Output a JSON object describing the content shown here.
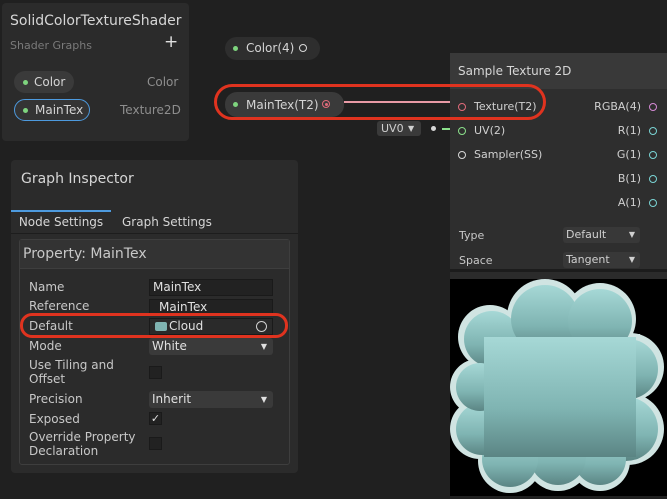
{
  "blackboard": {
    "title": "SolidColorTextureShader",
    "subtitle": "Shader Graphs",
    "add_label": "+",
    "properties": [
      {
        "name": "Color",
        "type": "Color"
      },
      {
        "name": "MainTex",
        "type": "Texture2D"
      }
    ]
  },
  "graph": {
    "color_node_label": "Color(4)",
    "maintex_node_label": "MainTex(T2)",
    "uv_value": "UV0",
    "accent_wire_color": "#e89aa6",
    "highlight_color": "#e0331f"
  },
  "sample_node": {
    "title": "Sample Texture 2D",
    "inputs": [
      "Texture(T2)",
      "UV(2)",
      "Sampler(SS)"
    ],
    "outputs": [
      "RGBA(4)",
      "R(1)",
      "G(1)",
      "B(1)",
      "A(1)"
    ],
    "type_label": "Type",
    "type_value": "Default",
    "space_label": "Space",
    "space_value": "Tangent"
  },
  "inspector": {
    "title": "Graph Inspector",
    "tabs": [
      "Node Settings",
      "Graph Settings"
    ],
    "property_title": "Property: MainTex",
    "fields": {
      "name_label": "Name",
      "name_value": "MainTex",
      "reference_label": "Reference",
      "reference_value": "_MainTex",
      "default_label": "Default",
      "default_value": "Cloud",
      "mode_label": "Mode",
      "mode_value": "White",
      "tiling_label": "Use Tiling and Offset",
      "tiling_checked": false,
      "precision_label": "Precision",
      "precision_value": "Inherit",
      "exposed_label": "Exposed",
      "exposed_checked": true,
      "override_label": "Override Property Declaration",
      "override_checked": false
    }
  }
}
